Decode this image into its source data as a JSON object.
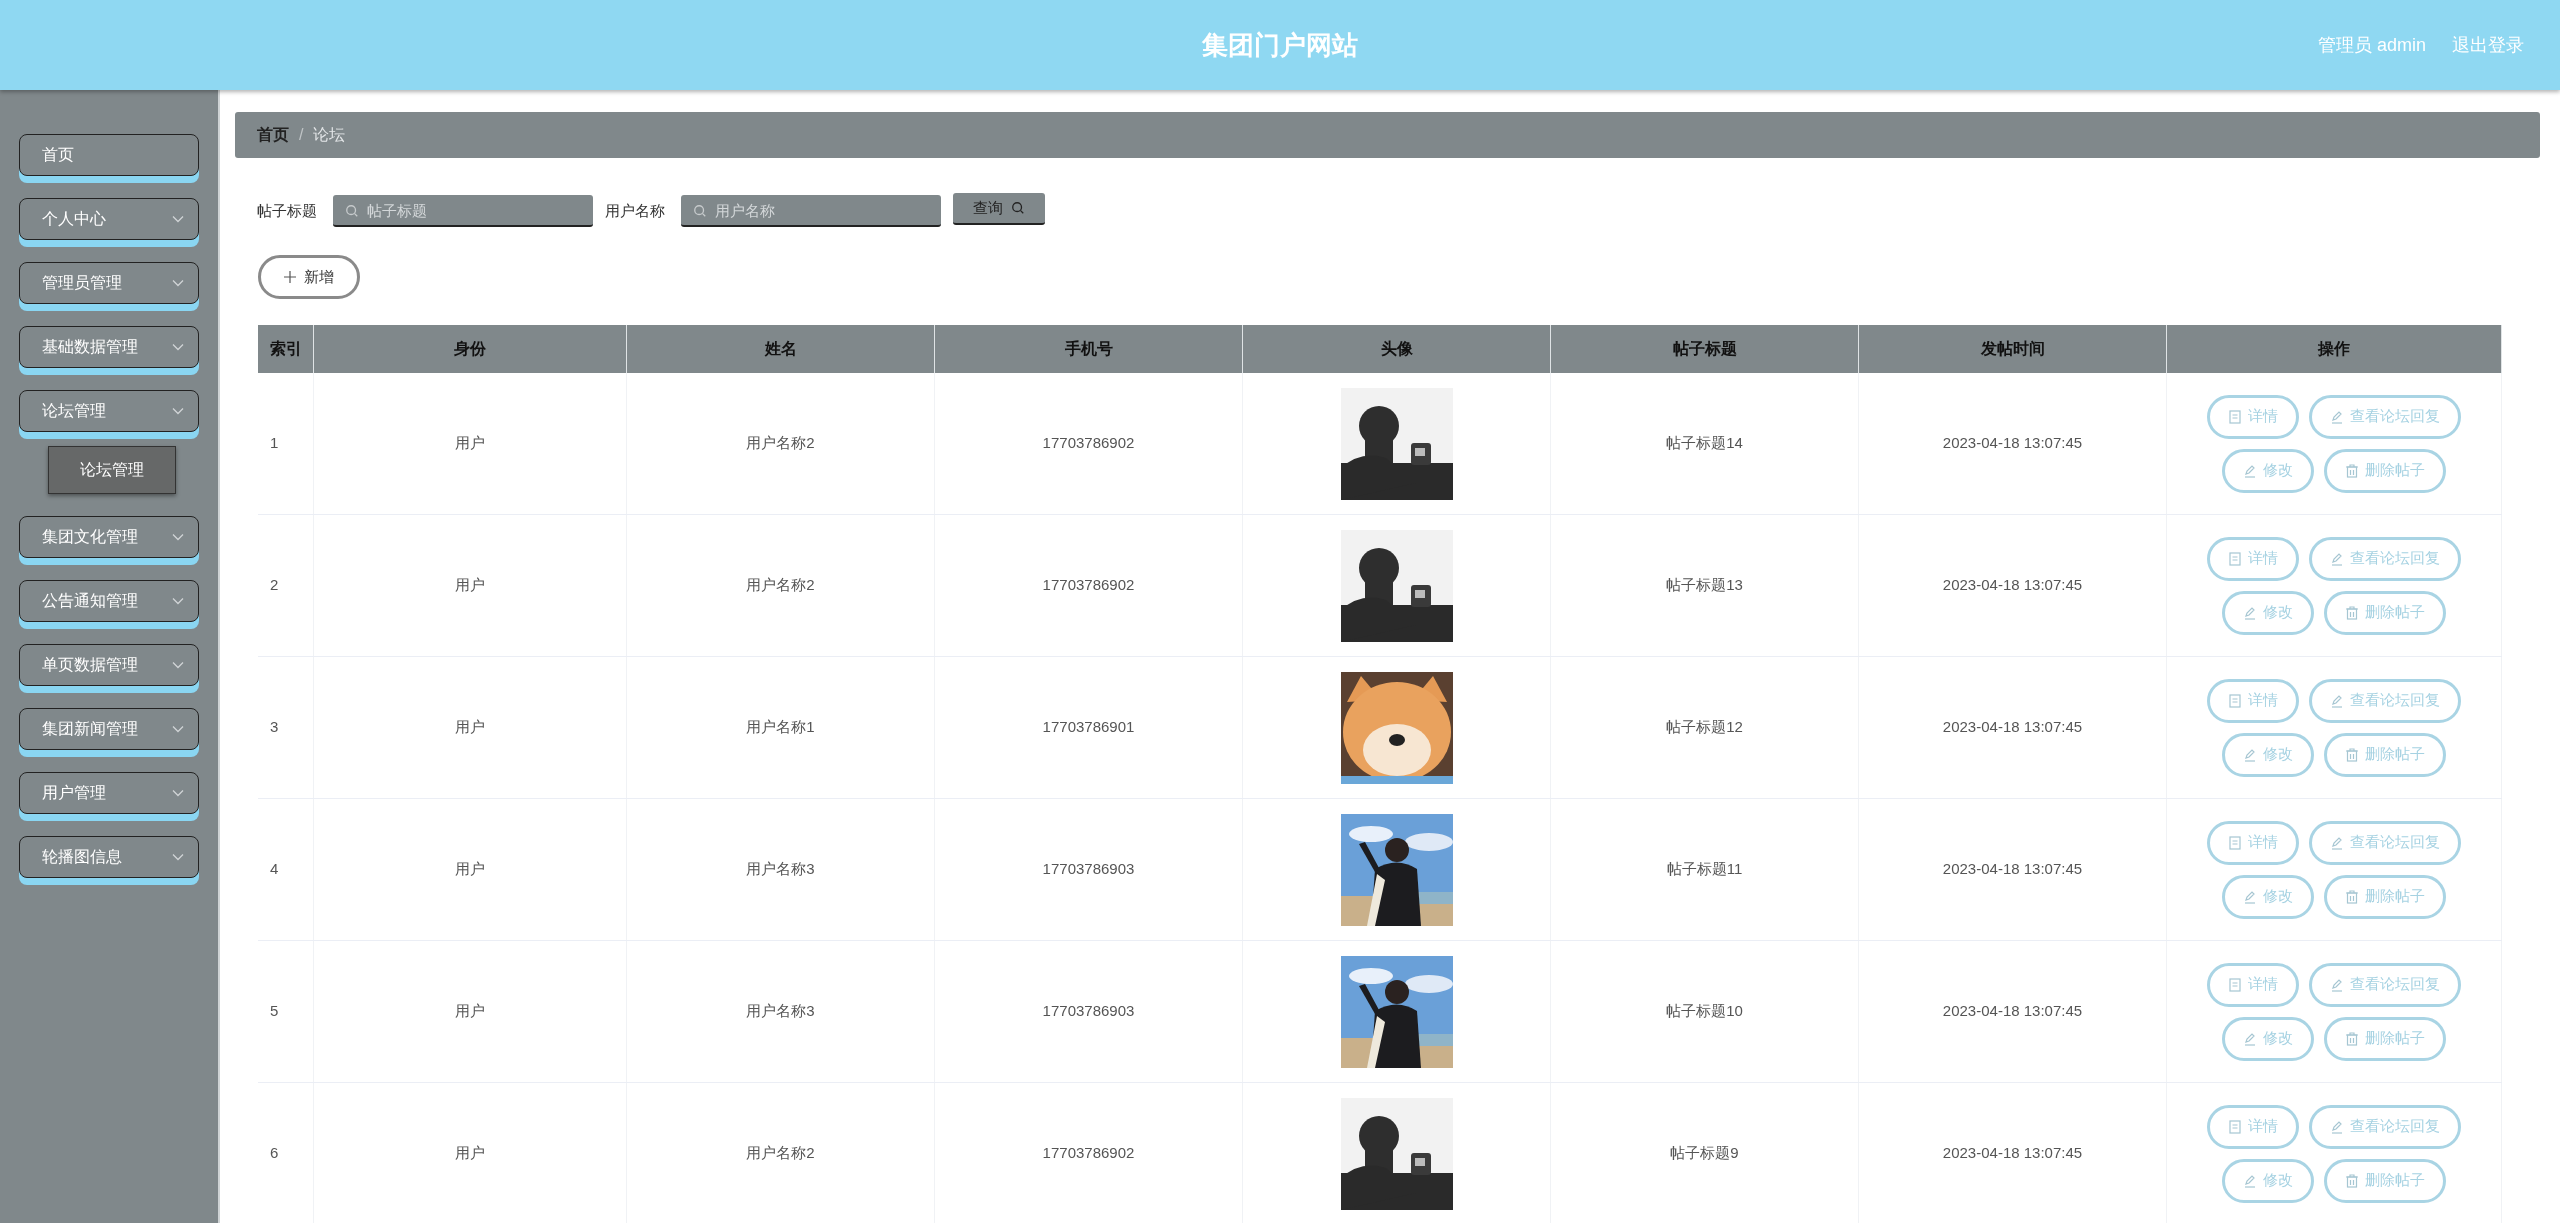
{
  "header": {
    "title": "集团门户网站",
    "user": "管理员 admin",
    "logout": "退出登录"
  },
  "sidebar": {
    "items": [
      {
        "label": "首页",
        "kind": "link"
      },
      {
        "label": "个人中心",
        "kind": "menu"
      },
      {
        "label": "管理员管理",
        "kind": "menu"
      },
      {
        "label": "基础数据管理",
        "kind": "menu"
      },
      {
        "label": "论坛管理",
        "kind": "menu",
        "children": [
          {
            "label": "论坛管理",
            "selected": true
          }
        ]
      },
      {
        "label": "集团文化管理",
        "kind": "menu"
      },
      {
        "label": "公告通知管理",
        "kind": "menu"
      },
      {
        "label": "单页数据管理",
        "kind": "menu"
      },
      {
        "label": "集团新闻管理",
        "kind": "menu"
      },
      {
        "label": "用户管理",
        "kind": "menu"
      },
      {
        "label": "轮播图信息",
        "kind": "menu"
      }
    ]
  },
  "breadcrumb": {
    "separator": "/",
    "items": [
      {
        "label": "首页",
        "current": false
      },
      {
        "label": "论坛",
        "current": true
      }
    ]
  },
  "search": {
    "fields": [
      {
        "label": "帖子标题",
        "placeholder": "帖子标题"
      },
      {
        "label": "用户名称",
        "placeholder": "用户名称"
      }
    ],
    "button": "查询"
  },
  "add_button": "新增",
  "table": {
    "columns": [
      "索引",
      "身份",
      "姓名",
      "手机号",
      "头像",
      "帖子标题",
      "发帖时间",
      "操作"
    ],
    "rows": [
      {
        "index": "1",
        "role": "用户",
        "name": "用户名称2",
        "phone": "17703786902",
        "title": "帖子标题14",
        "time": "2023-04-18 13:07:45",
        "actions": [
          {
            "label": "详情",
            "kind": "detail"
          },
          {
            "label": "查看论坛回复",
            "kind": "edit"
          },
          {
            "label": "修改",
            "kind": "edit"
          },
          {
            "label": "删除帖子",
            "kind": "delete"
          }
        ]
      },
      {
        "index": "2",
        "role": "用户",
        "name": "用户名称2",
        "phone": "17703786902",
        "title": "帖子标题13",
        "time": "2023-04-18 13:07:45",
        "actions": [
          {
            "label": "详情",
            "kind": "detail"
          },
          {
            "label": "查看论坛回复",
            "kind": "edit"
          },
          {
            "label": "修改",
            "kind": "edit"
          },
          {
            "label": "删除帖子",
            "kind": "delete"
          }
        ]
      },
      {
        "index": "3",
        "role": "用户",
        "name": "用户名称1",
        "phone": "17703786901",
        "title": "帖子标题12",
        "time": "2023-04-18 13:07:45",
        "actions": [
          {
            "label": "详情",
            "kind": "detail"
          },
          {
            "label": "查看论坛回复",
            "kind": "edit"
          },
          {
            "label": "修改",
            "kind": "edit"
          },
          {
            "label": "删除帖子",
            "kind": "delete"
          }
        ]
      },
      {
        "index": "4",
        "role": "用户",
        "name": "用户名称3",
        "phone": "17703786903",
        "title": "帖子标题11",
        "time": "2023-04-18 13:07:45",
        "actions": [
          {
            "label": "详情",
            "kind": "detail"
          },
          {
            "label": "查看论坛回复",
            "kind": "edit"
          },
          {
            "label": "修改",
            "kind": "edit"
          },
          {
            "label": "删除帖子",
            "kind": "delete"
          }
        ]
      },
      {
        "index": "5",
        "role": "用户",
        "name": "用户名称3",
        "phone": "17703786903",
        "title": "帖子标题10",
        "time": "2023-04-18 13:07:45",
        "actions": [
          {
            "label": "详情",
            "kind": "detail"
          },
          {
            "label": "查看论坛回复",
            "kind": "edit"
          },
          {
            "label": "修改",
            "kind": "edit"
          },
          {
            "label": "删除帖子",
            "kind": "delete"
          }
        ]
      },
      {
        "index": "6",
        "role": "用户",
        "name": "用户名称2",
        "phone": "17703786902",
        "title": "帖子标题9",
        "time": "2023-04-18 13:07:45",
        "actions": [
          {
            "label": "详情",
            "kind": "detail"
          },
          {
            "label": "查看论坛回复",
            "kind": "edit"
          },
          {
            "label": "修改",
            "kind": "edit"
          },
          {
            "label": "删除帖子",
            "kind": "delete"
          }
        ]
      }
    ]
  }
}
